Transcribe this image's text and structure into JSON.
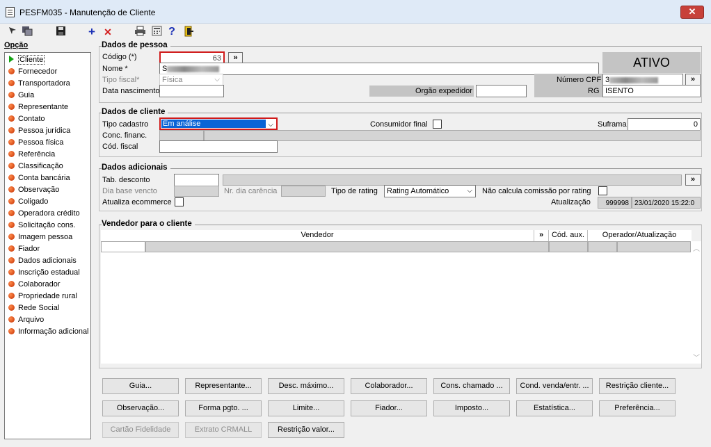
{
  "window": {
    "title": "PESFM035 - Manutenção de Cliente",
    "close_glyph": "✕"
  },
  "toolbar": {
    "icons": [
      "select-icon",
      "window-icon",
      "save-icon",
      "add-icon",
      "delete-icon",
      "print-icon",
      "calculator-icon",
      "help-icon",
      "exit-door-icon"
    ],
    "add_glyph": "+",
    "delete_glyph": "✕",
    "help_glyph": "?"
  },
  "sidebar": {
    "title": "Opção",
    "items": [
      {
        "label": "Cliente",
        "selected": true
      },
      {
        "label": "Fornecedor"
      },
      {
        "label": "Transportadora"
      },
      {
        "label": "Guia"
      },
      {
        "label": "Representante"
      },
      {
        "label": "Contato"
      },
      {
        "label": "Pessoa jurídica"
      },
      {
        "label": "Pessoa física"
      },
      {
        "label": "Referência"
      },
      {
        "label": "Classificação"
      },
      {
        "label": "Conta bancária"
      },
      {
        "label": "Observação"
      },
      {
        "label": "Coligado"
      },
      {
        "label": "Operadora crédito"
      },
      {
        "label": "Solicitação cons."
      },
      {
        "label": "Imagem pessoa"
      },
      {
        "label": "Fiador"
      },
      {
        "label": "Dados adicionais"
      },
      {
        "label": "Inscrição estadual"
      },
      {
        "label": "Colaborador"
      },
      {
        "label": "Propriedade rural"
      },
      {
        "label": "Rede Social"
      },
      {
        "label": "Arquivo"
      },
      {
        "label": "Informação adicional"
      }
    ]
  },
  "dados_pessoa": {
    "title": "Dados de pessoa",
    "codigo_label": "Código (*)",
    "codigo_value": "63",
    "nome_label": "Nome *",
    "nome_value": "S",
    "tipo_fiscal_label": "Tipo fiscal*",
    "tipo_fiscal_value": "Física",
    "data_nasc_label": "Data nascimento",
    "orgao_label": "Orgão expedidor",
    "status": "ATIVO",
    "cpf_label": "Número CPF",
    "cpf_value": "3",
    "rg_label": "RG",
    "rg_value": "ISENTO",
    "more_glyph": "»"
  },
  "dados_cliente": {
    "title": "Dados de cliente",
    "tipo_cadastro_label": "Tipo cadastro",
    "tipo_cadastro_value": "Em análise",
    "consumidor_label": "Consumidor final",
    "suframa_label": "Suframa",
    "suframa_value": "0",
    "conc_label": "Conc. financ.",
    "cod_fiscal_label": "Cód. fiscal"
  },
  "dados_adicionais": {
    "title": "Dados adicionais",
    "tab_desconto_label": "Tab. desconto",
    "dia_base_label": "Dia base vencto",
    "nr_dia_label": "Nr. dia carência",
    "tipo_rating_label": "Tipo de rating",
    "tipo_rating_value": "Rating Automático",
    "nao_calcula_label": "Não calcula comissão por rating",
    "atualiza_label": "Atualiza ecommerce",
    "atualizacao_label": "Atualização",
    "atualizacao_user": "999998",
    "atualizacao_date": "23/01/2020 15:22:0"
  },
  "vendedor": {
    "title": "Vendedor para o cliente",
    "col_vendedor": "Vendedor",
    "col_more": "»",
    "col_cod_aux": "Cód. aux.",
    "col_operador": "Operador/Atualização"
  },
  "buttons": {
    "row1": [
      "Guia...",
      "Representante...",
      "Desc. máximo...",
      "Colaborador...",
      "Cons. chamado ...",
      "Cond. venda/entr. ...",
      "Restrição cliente..."
    ],
    "row2": [
      "Observação...",
      "Forma pgto. ...",
      "Limite...",
      "Fiador...",
      "Imposto...",
      "Estatística...",
      "Preferência..."
    ],
    "row3": [
      "Cartão Fidelidade",
      "Extrato CRMALL",
      "Restrição valor..."
    ]
  }
}
